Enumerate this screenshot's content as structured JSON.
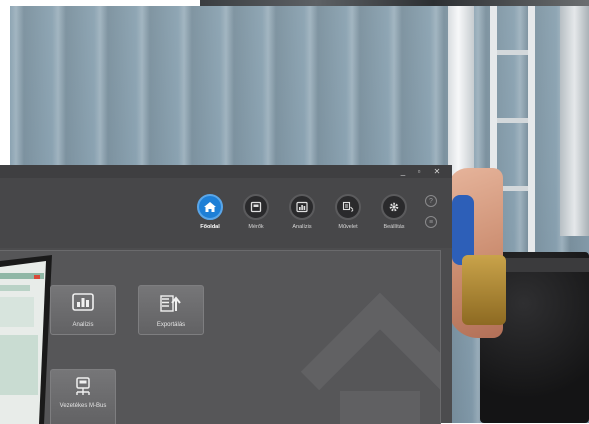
{
  "window": {
    "controls": {
      "minimize": "_",
      "maximize": "▫",
      "close": "✕"
    }
  },
  "nav": [
    {
      "label": "Főoldal",
      "icon": "home-icon",
      "active": true
    },
    {
      "label": "Mérők",
      "icon": "meter-icon",
      "active": false
    },
    {
      "label": "Analízis",
      "icon": "chart-icon",
      "active": false
    },
    {
      "label": "Művelet",
      "icon": "operation-icon",
      "active": false
    },
    {
      "label": "Beállítás",
      "icon": "gear-icon",
      "active": false
    }
  ],
  "help": {
    "question": "?",
    "chat": "≡"
  },
  "tiles": [
    {
      "label": "Analízis",
      "icon": "chart-icon"
    },
    {
      "label": "Exportálás",
      "icon": "export-icon"
    },
    {
      "label": "Vezetékes M-Bus",
      "icon": "mbus-icon"
    }
  ],
  "colors": {
    "accent": "#1e7fd6",
    "window_bg": "#4c4c4e",
    "content_bg": "#565658"
  }
}
